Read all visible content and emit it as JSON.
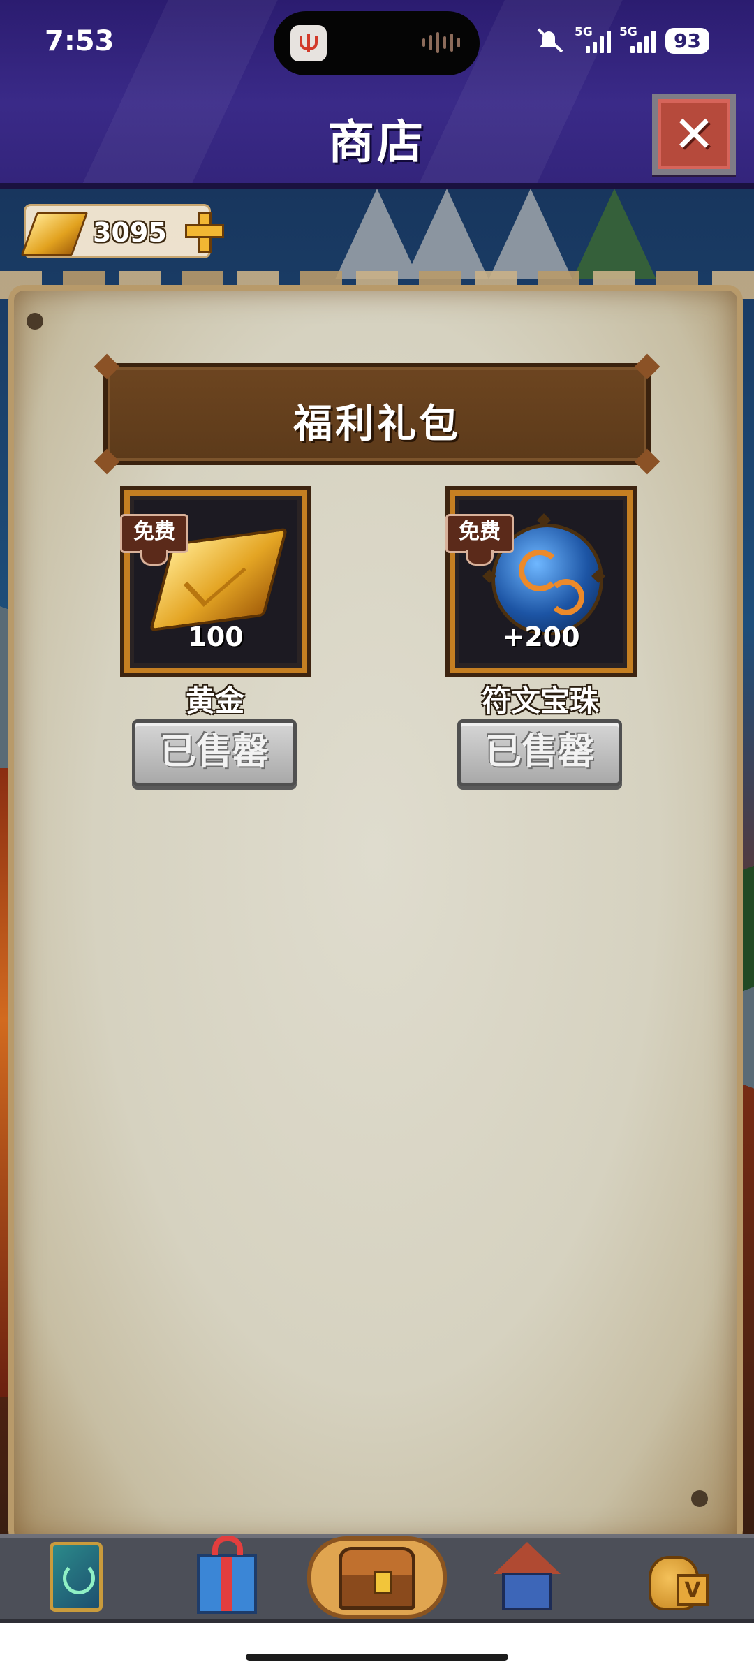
{
  "status_bar": {
    "time": "7:53",
    "network_1": "5G",
    "network_2": "5G",
    "battery": "93"
  },
  "header": {
    "title": "商店",
    "close_icon": "close-icon"
  },
  "currency": {
    "icon": "gold-bar-icon",
    "amount": "3095",
    "add_icon": "plus-icon"
  },
  "section": {
    "title": "福利礼包"
  },
  "offers": [
    {
      "tag": "免费",
      "icon": "gold-bar-icon",
      "quantity": "100",
      "name": "黄金",
      "button": "已售罄"
    },
    {
      "tag": "免费",
      "icon": "rune-orb-icon",
      "quantity": "+200",
      "name": "符文宝珠",
      "button": "已售罄"
    }
  ],
  "bottom_nav": {
    "items": [
      {
        "icon": "card-deck-icon"
      },
      {
        "icon": "gift-box-icon"
      },
      {
        "icon": "treasure-chest-icon",
        "active": true
      },
      {
        "icon": "tavern-house-icon"
      },
      {
        "icon": "gold-bag-icon"
      }
    ]
  },
  "colors": {
    "header_bg": "#3a2a88",
    "card_border": "#c57f22",
    "sold_button": "#a9a9a9",
    "close_button": "#b64a3c"
  }
}
